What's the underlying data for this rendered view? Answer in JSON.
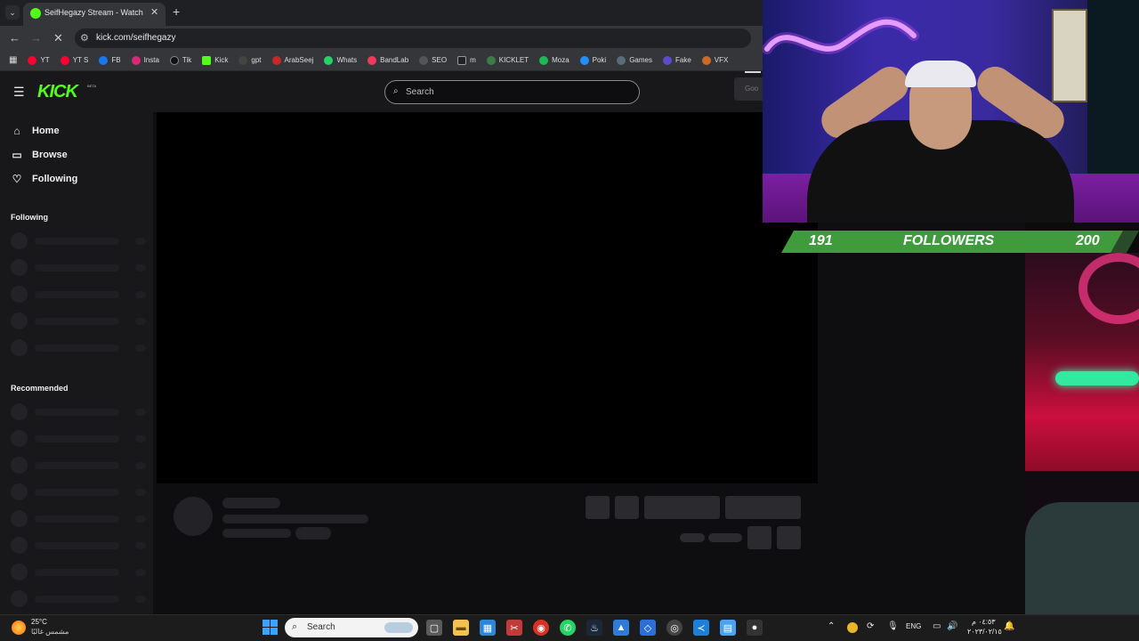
{
  "browser": {
    "tab_list_icon": "chevron-down-icon",
    "active_tab": {
      "title": "SeifHegazy Stream - Watch Live",
      "favicon": "kick-favicon-icon"
    },
    "new_tab_label": "+",
    "url": "kick.com/seifhegazy"
  },
  "bookmarks": [
    {
      "label": "YT",
      "color": "#ff0033"
    },
    {
      "label": "YT S",
      "color": "#ff0033"
    },
    {
      "label": "FB",
      "color": "#1877f2"
    },
    {
      "label": "Insta",
      "color": "#d62976"
    },
    {
      "label": "Tik",
      "color": "#111111"
    },
    {
      "label": "Kick",
      "color": "#53fc18"
    },
    {
      "label": "gpt",
      "color": "#444444"
    },
    {
      "label": "ArabSeej",
      "color": "#c62828"
    },
    {
      "label": "Whats",
      "color": "#25d366"
    },
    {
      "label": "BandLab",
      "color": "#f2385a"
    },
    {
      "label": "SEO",
      "color": "#555555"
    },
    {
      "label": "m",
      "color": "#222222"
    },
    {
      "label": "KICKLET",
      "color": "#3a7d44"
    },
    {
      "label": "Moza",
      "color": "#1db954"
    },
    {
      "label": "Poki",
      "color": "#1f8fff"
    },
    {
      "label": "Games",
      "color": "#5a6b7a"
    },
    {
      "label": "Fake",
      "color": "#5b4ccf"
    },
    {
      "label": "VFX",
      "color": "#c9692a"
    }
  ],
  "kick": {
    "logo": "KICK",
    "beta": "BETA",
    "search_placeholder": "Search",
    "google_hint": "Goo",
    "nav": [
      {
        "label": "Home",
        "icon": "home-icon",
        "glyph": "⌂"
      },
      {
        "label": "Browse",
        "icon": "browse-icon",
        "glyph": "▭"
      },
      {
        "label": "Following",
        "icon": "heart-icon",
        "glyph": "♡"
      }
    ],
    "following_title": "Following",
    "recommended_title": "Recommended"
  },
  "overlay": {
    "followers_current": "191",
    "followers_label": "FOLLOWERS",
    "followers_goal": "200",
    "followers_progress_fraction": 0.955
  },
  "taskbar": {
    "weather_temp": "25°C",
    "weather_desc": "مشمس غالبًا",
    "search_placeholder": "Search",
    "language": "ENG",
    "time": "٠٤:٥٣ م",
    "date": "٢٠٢٣/٠٢/١٥",
    "apps": [
      {
        "name": "task-view-icon",
        "color": "#5a5a5a",
        "glyph": "▢"
      },
      {
        "name": "file-explorer-icon",
        "color": "#f2c14e",
        "glyph": "▬"
      },
      {
        "name": "store-icon",
        "color": "#2b88d8",
        "glyph": "▦"
      },
      {
        "name": "snipping-icon",
        "color": "#c23b3b",
        "glyph": "✂"
      },
      {
        "name": "chrome-icon",
        "color": "#d93025",
        "glyph": "◉"
      },
      {
        "name": "whatsapp-icon",
        "color": "#25d366",
        "glyph": "✆"
      },
      {
        "name": "steam-icon",
        "color": "#1b2838",
        "glyph": "♨"
      },
      {
        "name": "photo-app-icon",
        "color": "#2f7bd8",
        "glyph": "▲"
      },
      {
        "name": "ai-app-icon",
        "color": "#2b6fd8",
        "glyph": "◇"
      },
      {
        "name": "obs-icon",
        "color": "#444444",
        "glyph": "◎"
      },
      {
        "name": "vscode-icon",
        "color": "#1e7fd8",
        "glyph": "≺"
      },
      {
        "name": "notepad-icon",
        "color": "#4aa3f0",
        "glyph": "▤"
      },
      {
        "name": "microphone-app-icon",
        "color": "#333333",
        "glyph": "🎙"
      }
    ]
  }
}
